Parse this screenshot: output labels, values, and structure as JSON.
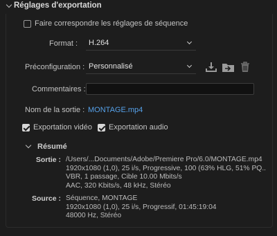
{
  "section": {
    "title": "Réglages d'exportation"
  },
  "match_sequence": {
    "label": "Faire correspondre les réglages de séquence",
    "checked": false
  },
  "format": {
    "label": "Format :",
    "value": "H.264"
  },
  "preset": {
    "label": "Préconfiguration :",
    "value": "Personnalisé",
    "icons": [
      "save-preset-icon",
      "import-preset-icon",
      "delete-preset-icon"
    ]
  },
  "comments": {
    "label": "Commentaires :",
    "value": ""
  },
  "output": {
    "label": "Nom de la sortie :",
    "value": "MONTAGE.mp4"
  },
  "export_video": {
    "label": "Exportation vidéo",
    "checked": true
  },
  "export_audio": {
    "label": "Exportation audio",
    "checked": true
  },
  "summary": {
    "title": "Résumé",
    "output_key": "Sortie :",
    "output_lines": [
      "/Users/...Documents/Adobe/Premiere Pro/6.0/MONTAGE.mp4",
      "1920x1080 (1,0), 25 i/s, Progressive, 100 (63% HLG, 51% PQ..",
      "VBR, 1 passage, Cible 10.00  Mbits/s",
      "AAC, 320  Kbits/s, 48  kHz, Stéréo"
    ],
    "source_key": "Source :",
    "source_lines": [
      "Séquence, MONTAGE",
      "1920x1080 (1,0), 25  i/s, Progressif, 01:45:19:04",
      "48000 Hz, Stéréo"
    ]
  },
  "colors": {
    "background": "#1d1d1d",
    "link": "#56a1e9",
    "text": "#c4c4c4"
  }
}
